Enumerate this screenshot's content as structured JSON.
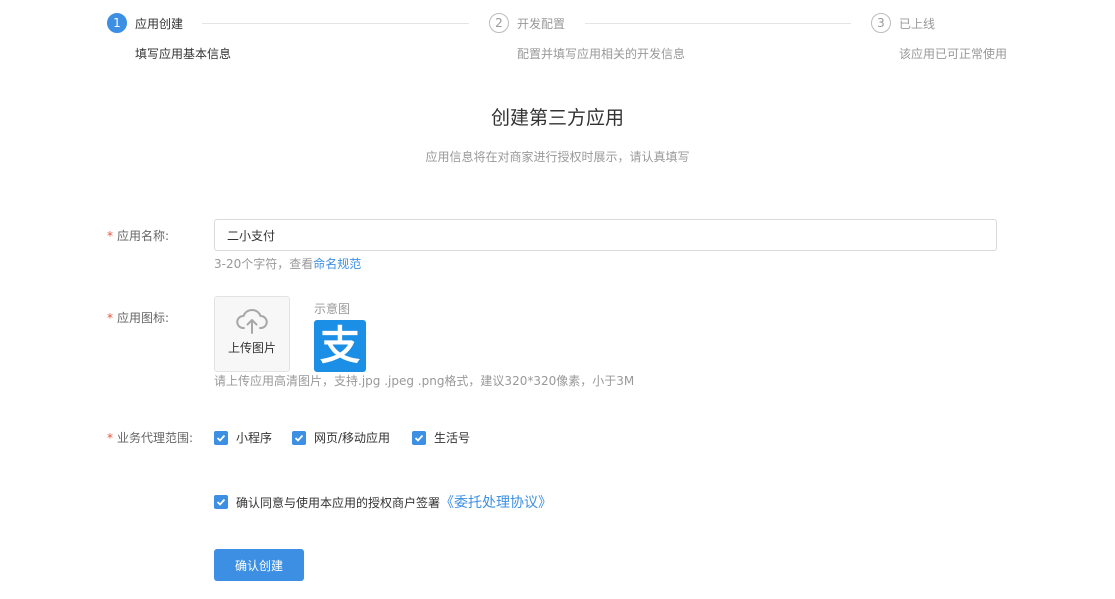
{
  "steps": [
    {
      "num": "1",
      "title": "应用创建",
      "desc": "填写应用基本信息"
    },
    {
      "num": "2",
      "title": "开发配置",
      "desc": "配置并填写应用相关的开发信息"
    },
    {
      "num": "3",
      "title": "已上线",
      "desc": "该应用已可正常使用"
    }
  ],
  "page": {
    "title": "创建第三方应用",
    "subtitle": "应用信息将在对商家进行授权时展示，请认真填写"
  },
  "form": {
    "required_mark": "*",
    "name_label": "应用名称:",
    "name_value": "二小支付",
    "name_hint": "3-20个字符，查看",
    "name_hint_link": "命名规范",
    "icon_label": "应用图标:",
    "upload_label": "上传图片",
    "sample_label": "示意图",
    "sample_glyph": "支",
    "icon_hint": "请上传应用高清图片，支持.jpg .jpeg .png格式，建议320*320像素，小于3M",
    "scope_label": "业务代理范围:",
    "scope_options": [
      "小程序",
      "网页/移动应用",
      "生活号"
    ],
    "agree_text": "确认同意与使用本应用的授权商户签署",
    "agree_link": "《委托处理协议》",
    "submit_label": "确认创建"
  },
  "colors": {
    "primary": "#3d8fe4",
    "required": "#e6553f"
  }
}
